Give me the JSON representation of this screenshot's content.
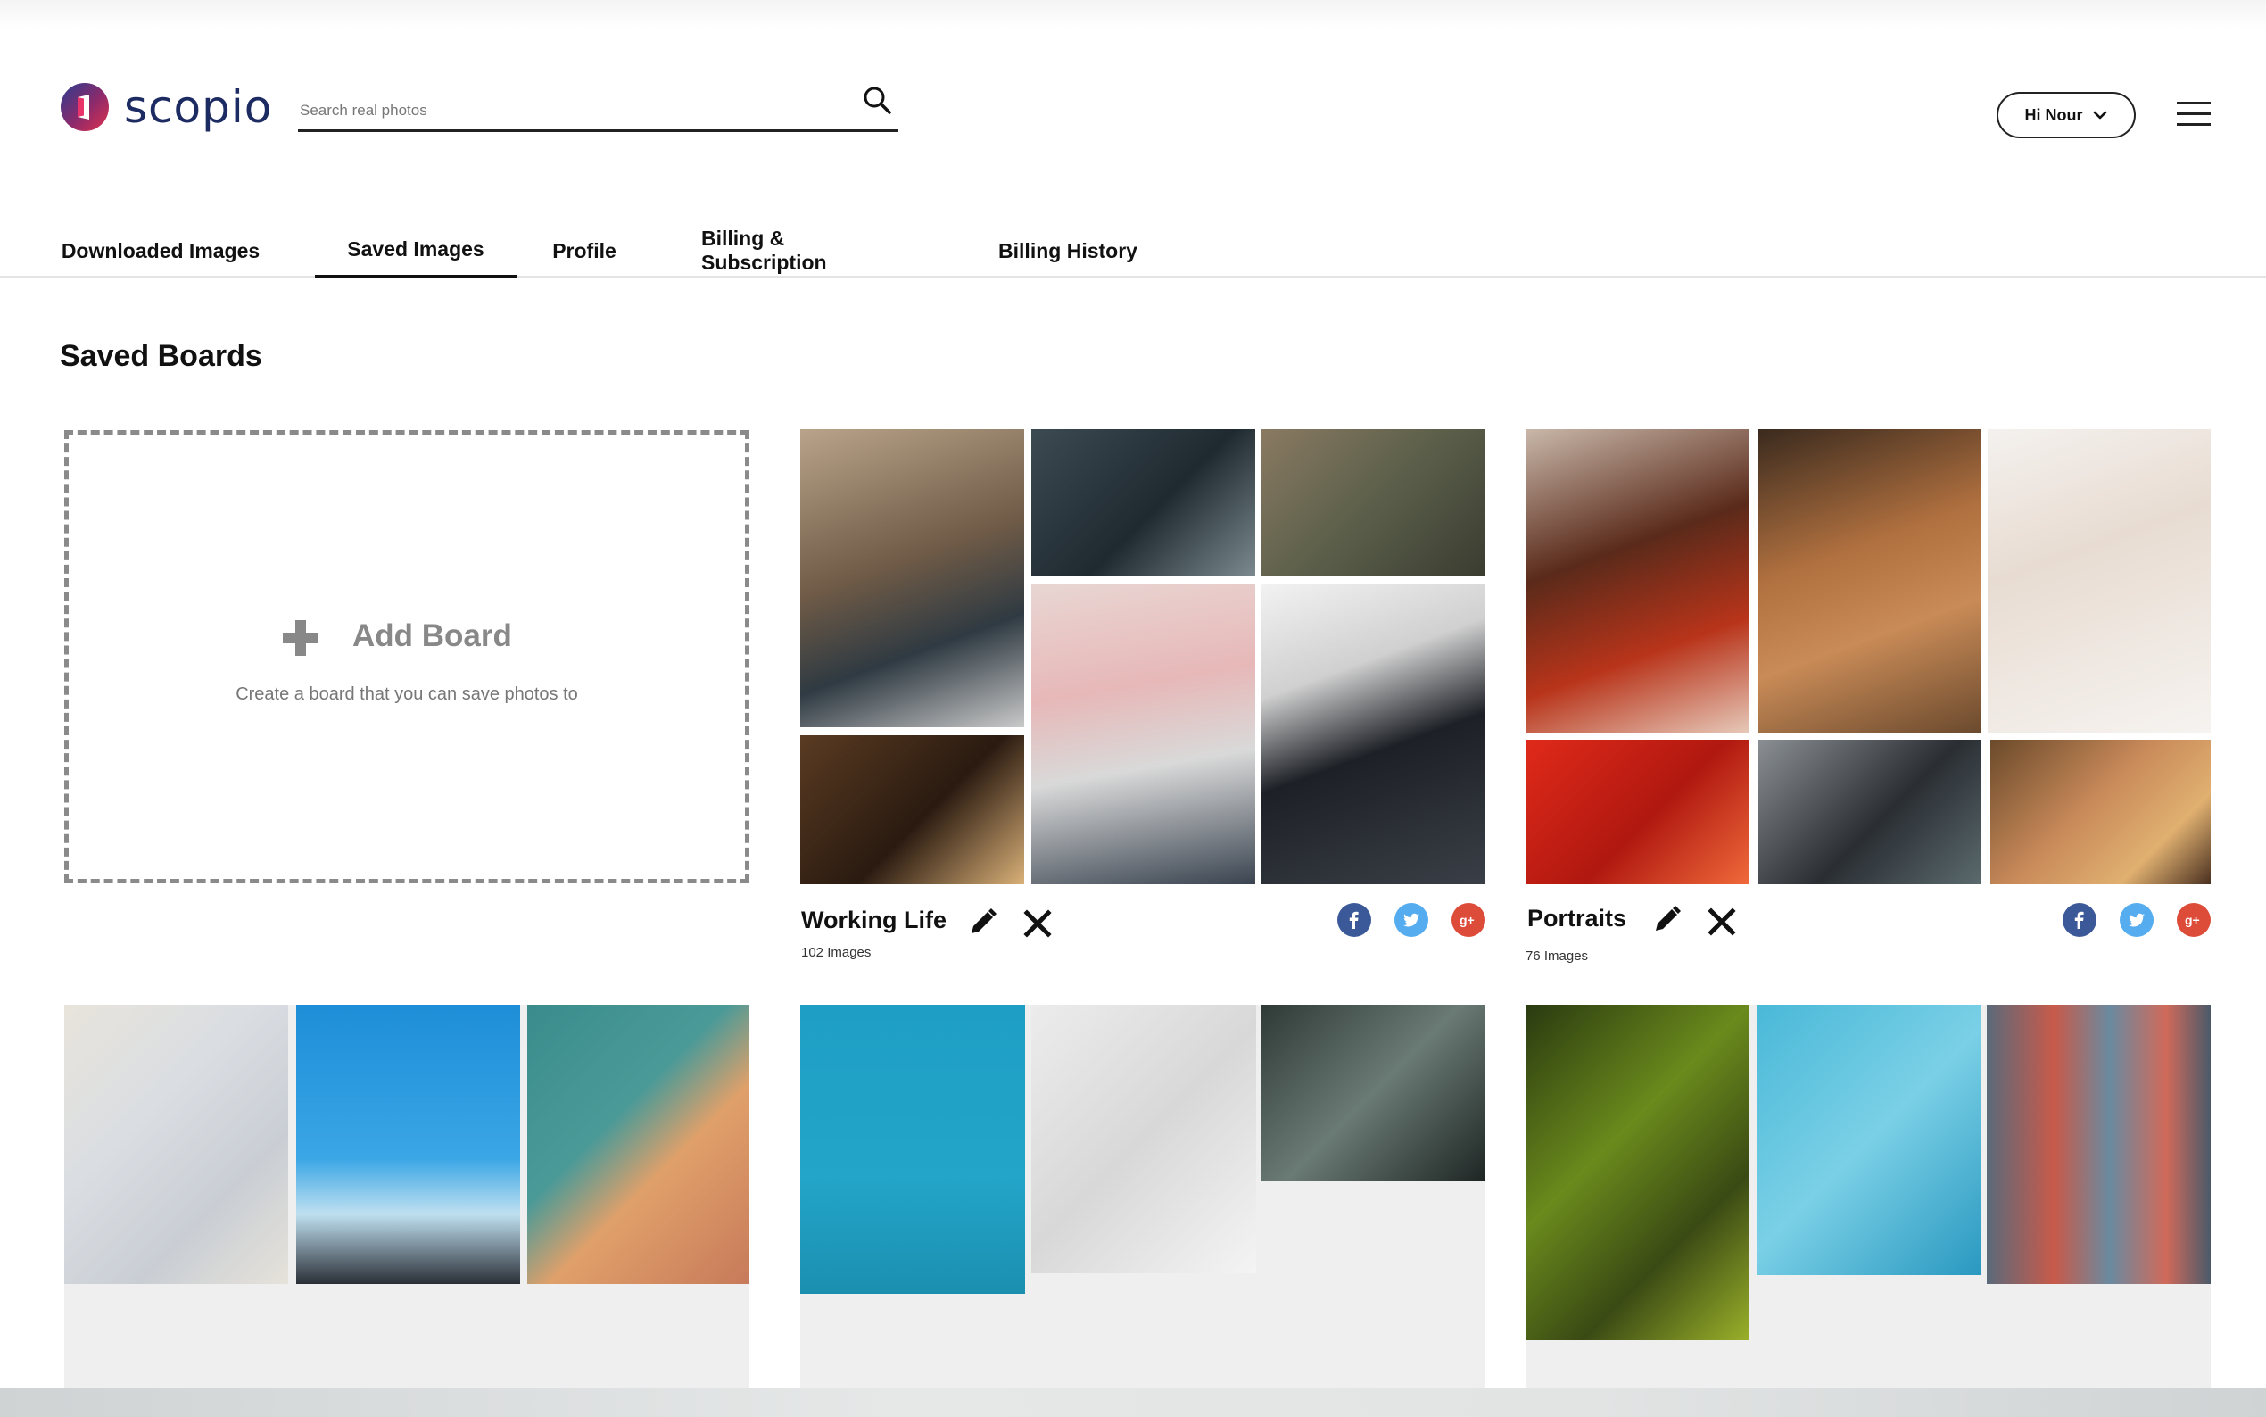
{
  "brand": {
    "name": "scopio",
    "color": "#1d2b63"
  },
  "search": {
    "placeholder": "Search real photos"
  },
  "user": {
    "greeting": "Hi Nour"
  },
  "tabs": [
    {
      "label": "Downloaded Images",
      "active": false
    },
    {
      "label": "Saved Images",
      "active": true
    },
    {
      "label": "Profile",
      "active": false
    },
    {
      "label": "Billing & Subscription",
      "active": false
    },
    {
      "label": "Billing History",
      "active": false
    }
  ],
  "section": {
    "title": "Saved Boards"
  },
  "add_board": {
    "title": "Add Board",
    "subtitle": "Create a board that you can save photos to"
  },
  "boards": [
    {
      "name": "Working Life",
      "count": "102 Images"
    },
    {
      "name": "Portraits",
      "count": "76 Images"
    }
  ],
  "icons": {
    "search": "search-icon",
    "chevron": "chevron-down-icon",
    "menu": "hamburger-menu-icon",
    "plus": "plus-icon",
    "edit": "pencil-icon",
    "delete": "close-icon",
    "facebook": "facebook-icon",
    "twitter": "twitter-icon",
    "google": "google-plus-icon"
  },
  "colors": {
    "facebook": "#3b5998",
    "twitter": "#55acee",
    "google": "#dd4b39"
  }
}
